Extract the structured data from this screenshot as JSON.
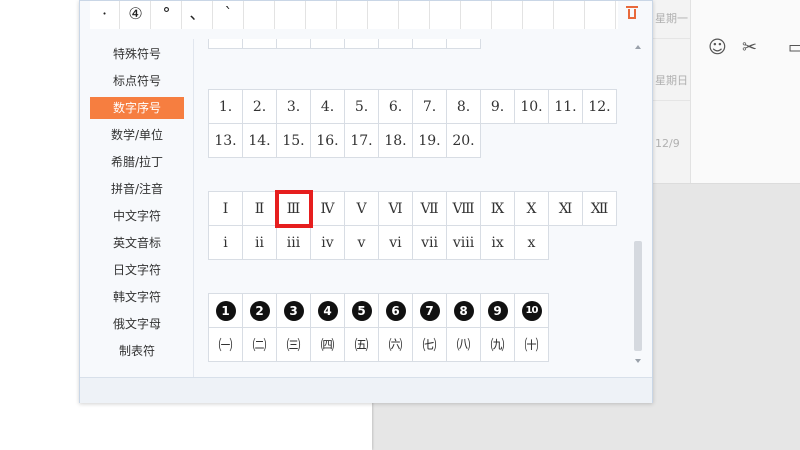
{
  "top_symbols": [
    "·",
    "④",
    "°",
    "、",
    "`"
  ],
  "categories": [
    {
      "label": "特殊符号"
    },
    {
      "label": "标点符号"
    },
    {
      "label": "数字序号",
      "active": true
    },
    {
      "label": "数学/单位"
    },
    {
      "label": "希腊/拉丁"
    },
    {
      "label": "拼音/注音"
    },
    {
      "label": "中文字符"
    },
    {
      "label": "英文音标"
    },
    {
      "label": "日文字符"
    },
    {
      "label": "韩文字符"
    },
    {
      "label": "俄文字母"
    },
    {
      "label": "制表符"
    }
  ],
  "arabic_row1": [
    "1.",
    "2.",
    "3.",
    "4.",
    "5.",
    "6.",
    "7.",
    "8.",
    "9.",
    "10.",
    "11.",
    "12."
  ],
  "arabic_row2": [
    "13.",
    "14.",
    "15.",
    "16.",
    "17.",
    "18.",
    "19.",
    "20."
  ],
  "roman_upper": [
    "Ⅰ",
    "Ⅱ",
    "Ⅲ",
    "Ⅳ",
    "Ⅴ",
    "Ⅵ",
    "Ⅶ",
    "Ⅷ",
    "Ⅸ",
    "Ⅹ",
    "Ⅺ",
    "Ⅻ"
  ],
  "roman_lower": [
    "ⅰ",
    "ⅱ",
    "ⅲ",
    "ⅳ",
    "ⅴ",
    "ⅵ",
    "ⅶ",
    "ⅷ",
    "ⅸ",
    "ⅹ"
  ],
  "selected_symbol": "Ⅲ",
  "circled": [
    "1",
    "2",
    "3",
    "4",
    "5",
    "6",
    "7",
    "8",
    "9",
    "10"
  ],
  "paren_cjk": [
    "㈠",
    "㈡",
    "㈢",
    "㈣",
    "㈤",
    "㈥",
    "㈦",
    "㈧",
    "㈨",
    "㈩"
  ],
  "background_app": {
    "times": [
      "星期一",
      "星期日",
      "12/9"
    ]
  },
  "colors": {
    "active_category": "#f67e40",
    "selection_outline": "#e61e1e",
    "trash_icon": "#e8693b"
  }
}
